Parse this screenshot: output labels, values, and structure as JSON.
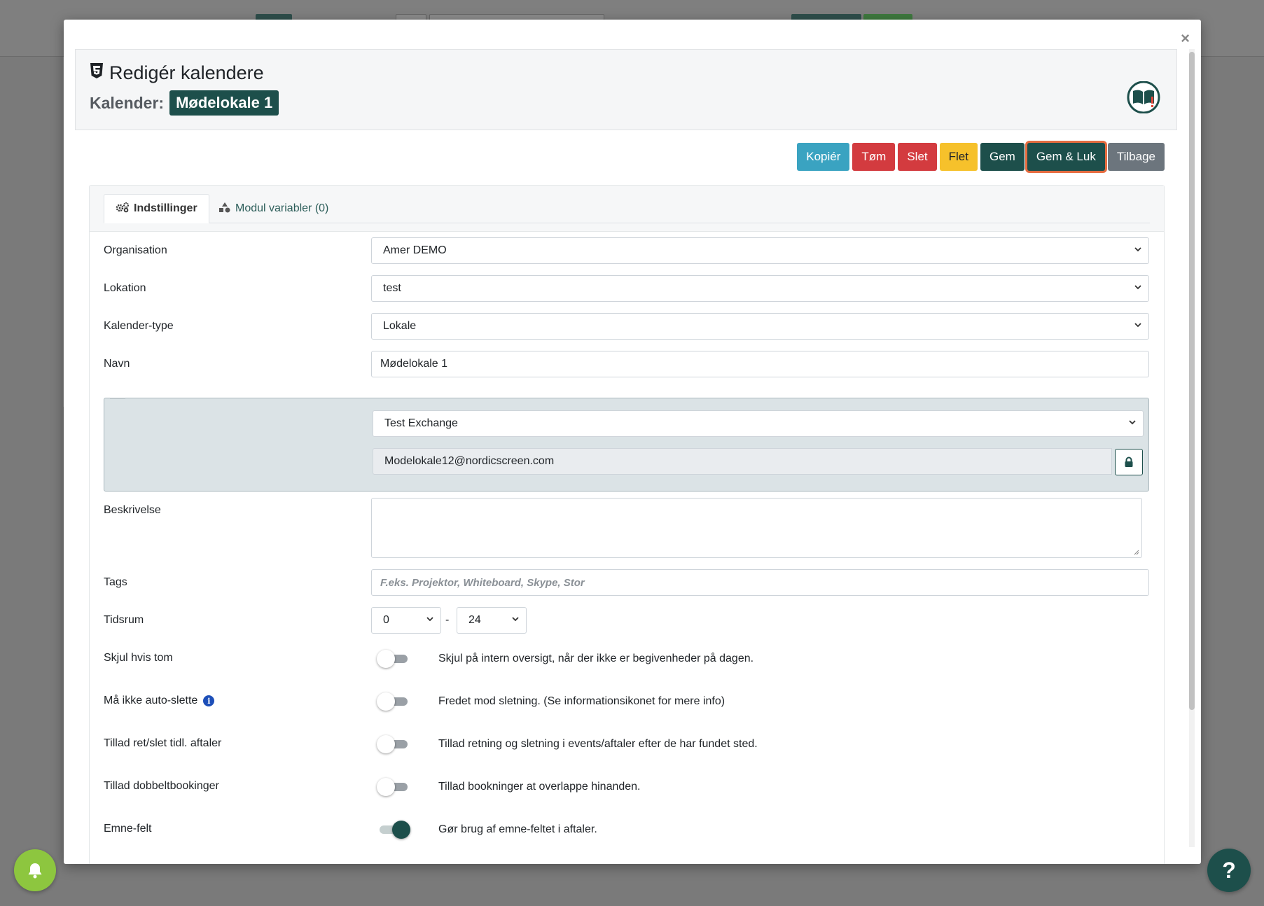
{
  "header": {
    "title": "Redigér kalendere",
    "calendar_label": "Kalender:",
    "calendar_name": "Mødelokale 1"
  },
  "toolbar": {
    "copy": "Kopiér",
    "empty": "Tøm",
    "delete": "Slet",
    "merge": "Flet",
    "save": "Gem",
    "save_close": "Gem & Luk",
    "back": "Tilbage"
  },
  "tabs": [
    {
      "label": "Indstillinger",
      "active": true
    },
    {
      "label": "Modul variabler (0)",
      "active": false
    }
  ],
  "form": {
    "organisation": {
      "label": "Organisation",
      "value": "Amer DEMO"
    },
    "lokation": {
      "label": "Lokation",
      "value": "test"
    },
    "kalender_type": {
      "label": "Kalender-type",
      "value": "Lokale"
    },
    "navn": {
      "label": "Navn",
      "value": "Mødelokale 1"
    },
    "exchange": {
      "provider": "Test Exchange",
      "email": "Modelokale12@nordicscreen.com"
    },
    "beskrivelse": {
      "label": "Beskrivelse",
      "value": ""
    },
    "tags": {
      "label": "Tags",
      "placeholder": "F.eks. Projektor, Whiteboard, Skype, Stor"
    },
    "tidsrum": {
      "label": "Tidsrum",
      "from": "0",
      "separator": "-",
      "to": "24"
    },
    "toggles": [
      {
        "label": "Skjul hvis tom",
        "desc": "Skjul på intern oversigt, når der ikke er begivenheder på dagen.",
        "on": false
      },
      {
        "label": "Må ikke auto-slette",
        "desc": "Fredet mod sletning. (Se informationsikonet for mere info)",
        "on": false,
        "info": true
      },
      {
        "label": "Tillad ret/slet tidl. aftaler",
        "desc": "Tillad retning og sletning i events/aftaler efter de har fundet sted.",
        "on": false
      },
      {
        "label": "Tillad dobbeltbookinger",
        "desc": "Tillad bookninger at overlappe hinanden.",
        "on": false
      },
      {
        "label": "Emne-felt",
        "desc": "Gør brug af emne-feltet i aftaler.",
        "on": true
      }
    ]
  },
  "floating": {
    "help": "?"
  },
  "colors": {
    "brand": "#1d4f4b",
    "info": "#3aa3c1",
    "danger": "#d33b3f",
    "warning": "#f6c12b",
    "secondary": "#6c757d",
    "notify": "#8dc63f"
  },
  "icons": [
    "html5-shield-icon",
    "book-alert-icon",
    "close-icon",
    "cogs-icon",
    "shapes-icon",
    "chevron-down-icon",
    "lock-icon",
    "info-icon",
    "bell-icon"
  ]
}
